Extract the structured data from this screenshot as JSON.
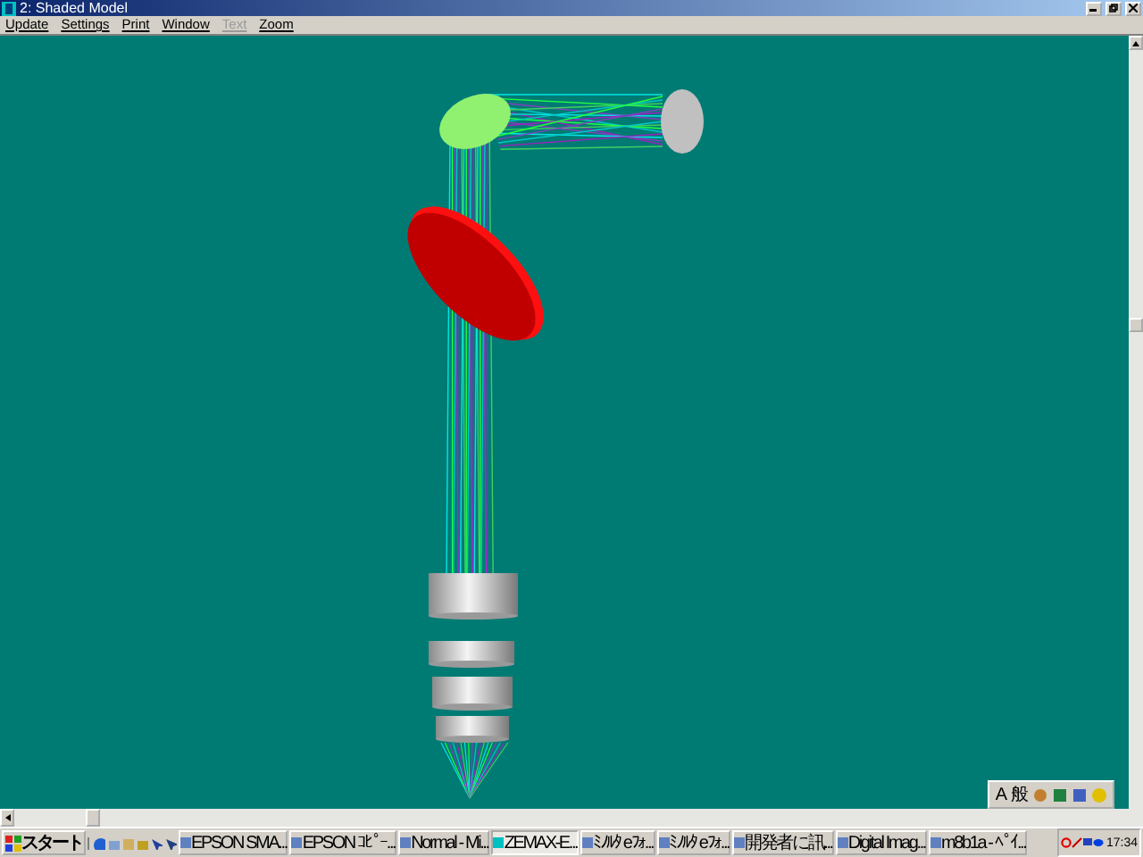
{
  "window": {
    "title": "2: Shaded Model"
  },
  "menu": [
    {
      "label": "Update",
      "disabled": false
    },
    {
      "label": "Settings",
      "disabled": false
    },
    {
      "label": "Print",
      "disabled": false
    },
    {
      "label": "Window",
      "disabled": false
    },
    {
      "label": "Text",
      "disabled": true
    },
    {
      "label": "Zoom",
      "disabled": false
    }
  ],
  "ime_bar": {
    "mode": "A",
    "input": "般"
  },
  "taskbar": {
    "start": "スタート",
    "tasks": [
      {
        "label": "EPSON SMA...",
        "selected": false
      },
      {
        "label": "EPSON ｺﾋﾟｰ...",
        "selected": false
      },
      {
        "label": "Normal - Mi...",
        "selected": false
      },
      {
        "label": "ZEMAX-E...",
        "selected": true
      },
      {
        "label": "ﾐﾉﾙﾀ eﾌｫ...",
        "selected": false
      },
      {
        "label": "ﾐﾉﾙﾀ eﾌｫ...",
        "selected": false
      },
      {
        "label": "開発者に訊...",
        "selected": false
      },
      {
        "label": "Digital Imag...",
        "selected": false
      },
      {
        "label": "m8b1a - ﾍﾟｲ...",
        "selected": false
      }
    ],
    "clock": "17:34"
  }
}
